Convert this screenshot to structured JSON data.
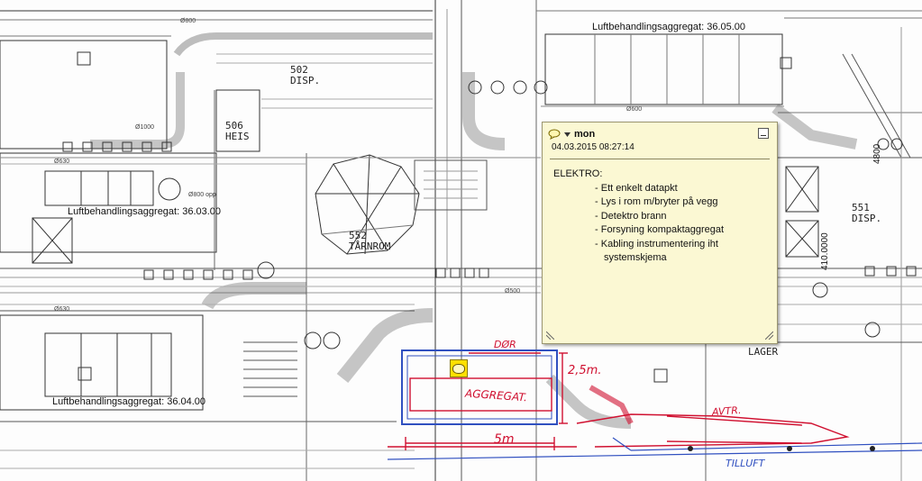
{
  "drawing": {
    "ahu_labels": {
      "top_right": "Luftbehandlingsaggregat: 36.05.00",
      "mid_left": "Luftbehandlingsaggregat: 36.03.00",
      "bottom_left": "Luftbehandlingsaggregat: 36.04.00"
    },
    "rooms": {
      "disp_502_num": "502",
      "disp_502_name": "DISP.",
      "heis_506_num": "506",
      "heis_506_name": "HEIS",
      "tarnrom_552_num": "552",
      "tarnrom_552_name": "TÅRNROM",
      "disp_551_num": "551",
      "disp_551_name": "DISP.",
      "lager": "LAGER"
    },
    "dimensions": {
      "d4800": "4800",
      "d410000": "410.0000",
      "o600": "Ø600",
      "o800": "Ø800",
      "o630": "Ø630",
      "o630b": "Ø630",
      "o500": "Ø500",
      "o800opp": "Ø800 opp",
      "o1000": "Ø1000"
    },
    "markup": {
      "dor": "DØR",
      "aggregat": "AGGREGAT.",
      "width_25": "2,5m.",
      "length_5": "5m",
      "avtr": "AVTR.",
      "tilluft": "TILLUFT"
    },
    "colors": {
      "markup_red": "#d01030",
      "markup_blue": "#3050c0",
      "note_bg": "#fbf8d3",
      "marker_yellow": "#ffe000"
    }
  },
  "comment": {
    "icon": "speech-bubble-icon",
    "author": "mon",
    "date": "04.03.2015 08:27:14",
    "heading": "ELEKTRO:",
    "items": [
      "Ett enkelt datapkt",
      "Lys i rom m/bryter på vegg",
      "Detektro brann",
      "Forsyning kompaktaggregat",
      "Kabling instrumentering iht systemskjema"
    ]
  }
}
